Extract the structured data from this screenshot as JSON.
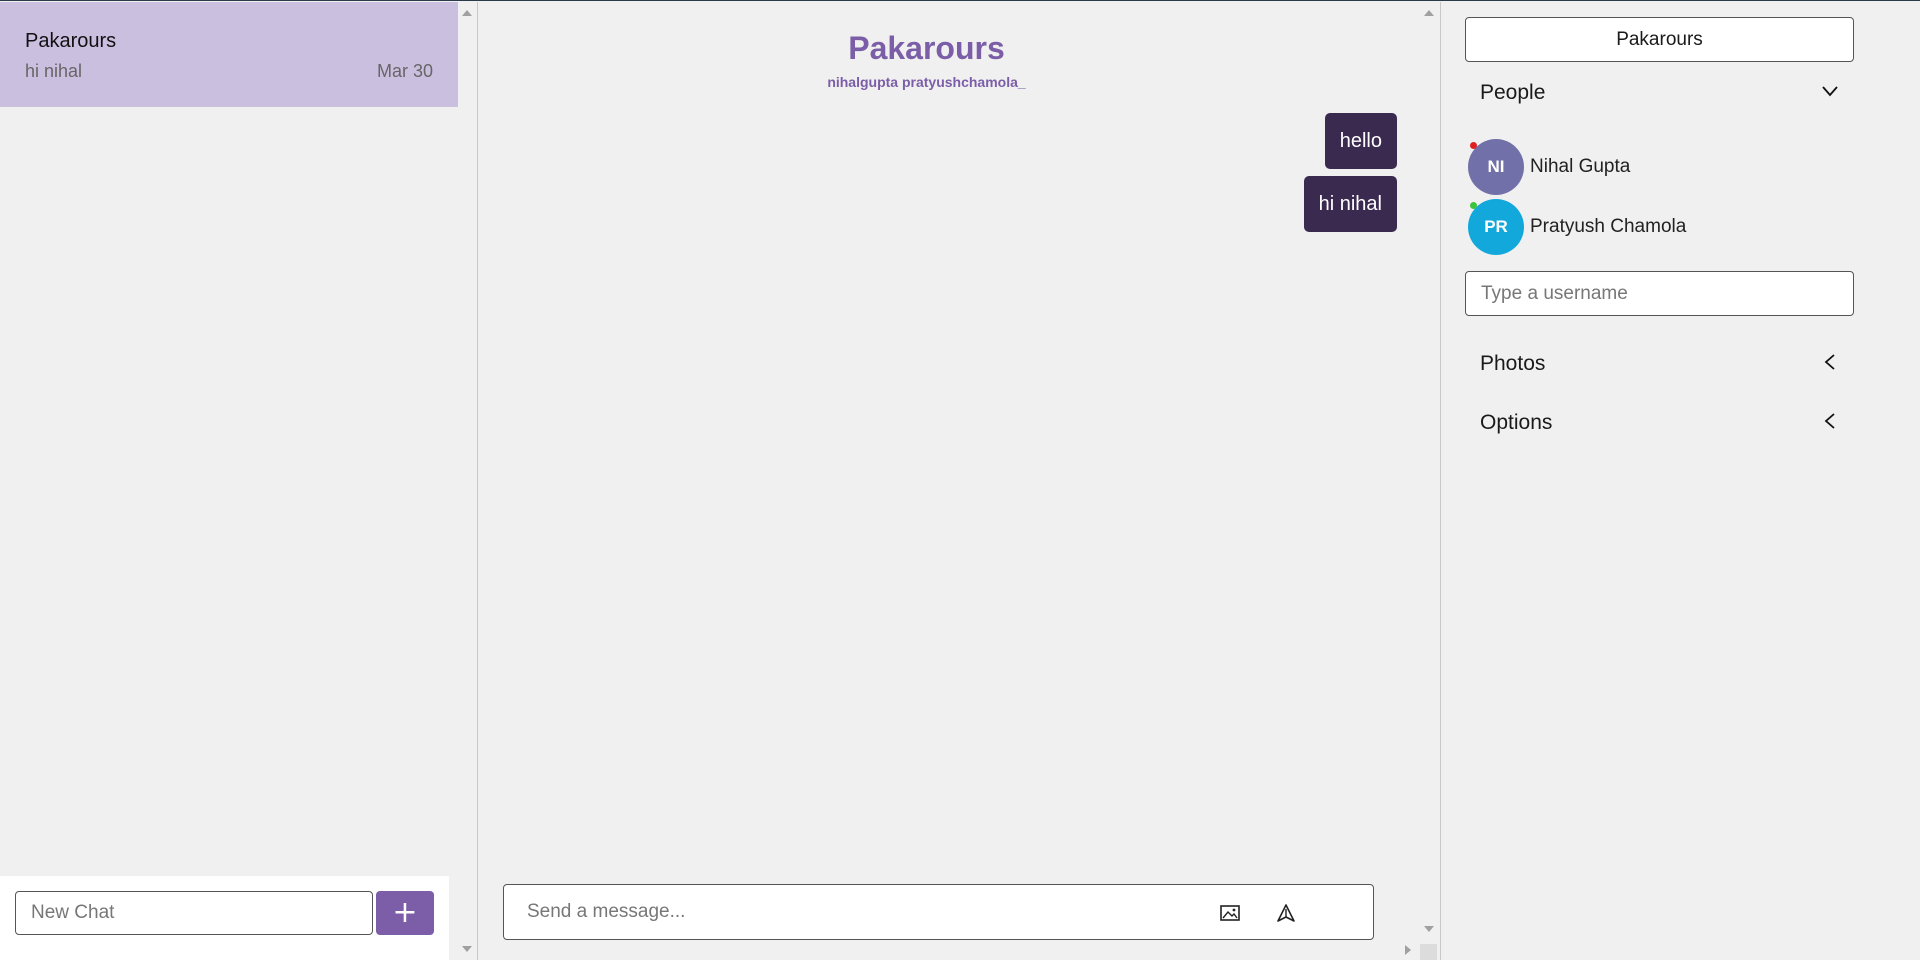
{
  "chat_list": {
    "items": [
      {
        "title": "Pakarours",
        "preview": "hi nihal",
        "date": "Mar 30",
        "selected_color": "#cbbfe0"
      }
    ],
    "new_chat": {
      "placeholder": "New Chat",
      "add_label": "+"
    }
  },
  "conversation": {
    "title": "Pakarours",
    "members": "nihalgupta pratyushchamola_",
    "accent_color": "#7b5ea7",
    "bubble_color": "#3a2a50",
    "messages": [
      {
        "text": "hello"
      },
      {
        "text": "hi nihal"
      }
    ],
    "composer": {
      "placeholder": "Send a message...",
      "attach_icon": "image-icon",
      "send_icon": "send-icon"
    }
  },
  "details": {
    "title": "Pakarours",
    "people": {
      "label": "People",
      "members": [
        {
          "initials": "NI",
          "name": "Nihal Gupta",
          "avatar_color": "#7170a8",
          "status_color": "#e02020"
        },
        {
          "initials": "PR",
          "name": "Pratyush Chamola",
          "avatar_color": "#13a8dc",
          "status_color": "#3cc43c"
        }
      ],
      "add_placeholder": "Type a username"
    },
    "photos": {
      "label": "Photos"
    },
    "options": {
      "label": "Options"
    }
  }
}
